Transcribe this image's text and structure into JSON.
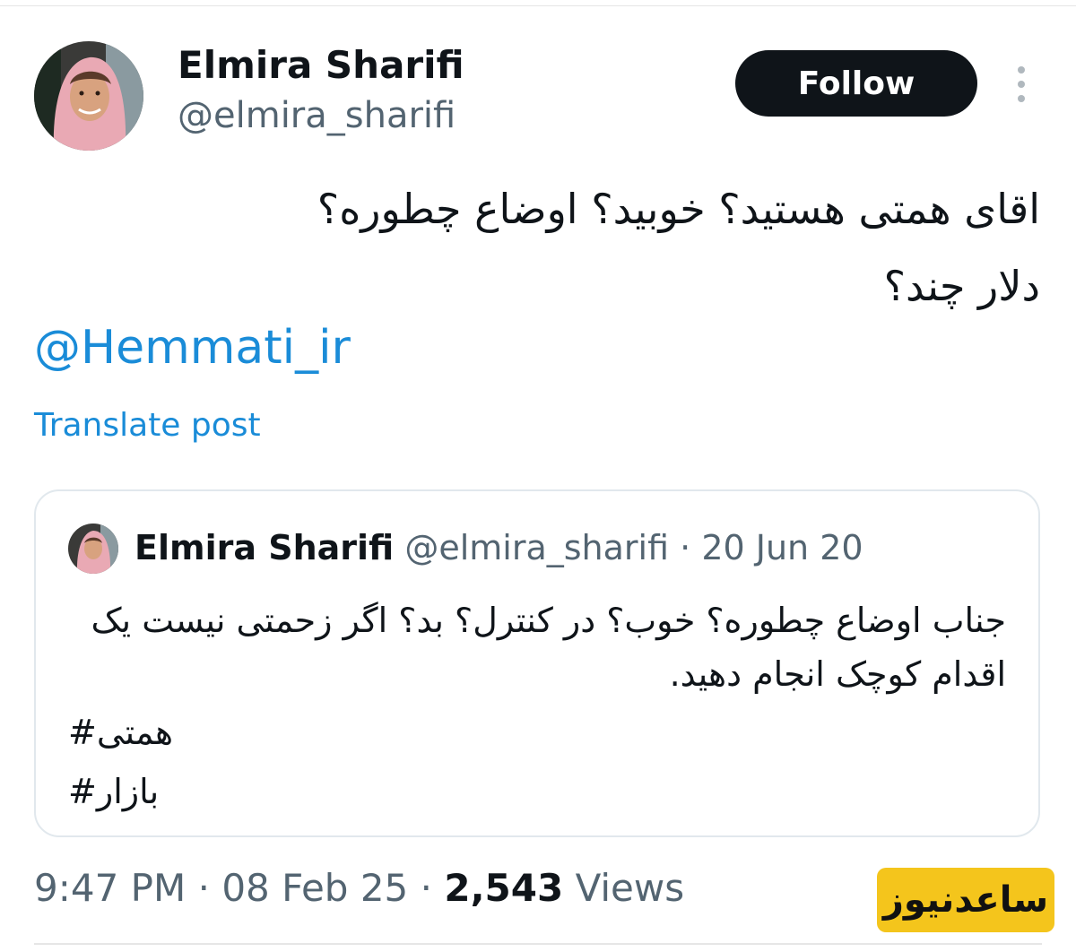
{
  "author": {
    "display_name": "Elmira Sharifi",
    "handle": "@elmira_sharifi"
  },
  "follow_label": "Follow",
  "tweet": {
    "lines": [
      "اقای همتی هستید؟ خوبید؟ اوضاع چطوره؟",
      "دلار چند؟"
    ],
    "mention": "@Hemmati_ir",
    "translate_label": "Translate post"
  },
  "quoted": {
    "display_name": "Elmira Sharifi",
    "handle": "@elmira_sharifi",
    "separator": "·",
    "date": "20 Jun 20",
    "lines": [
      "جناب اوضاع چطوره؟ خوب؟ در کنترل؟ بد؟ اگر زحمتی نیست یک",
      "اقدام کوچک انجام دهید."
    ],
    "hashtags": [
      "#همتی",
      "#بازار"
    ]
  },
  "footer": {
    "time": "9:47 PM",
    "separator": "·",
    "date": "08 Feb 25",
    "views_count": "2,543",
    "views_label": "Views"
  },
  "watermark": "ساعدنیوز",
  "colors": {
    "link": "#1a8cd8",
    "follow_bg": "#0f1419",
    "secondary_text": "#536471",
    "watermark_bg": "#f4c51c"
  },
  "icons": {
    "more": "vertical-ellipsis-icon"
  }
}
